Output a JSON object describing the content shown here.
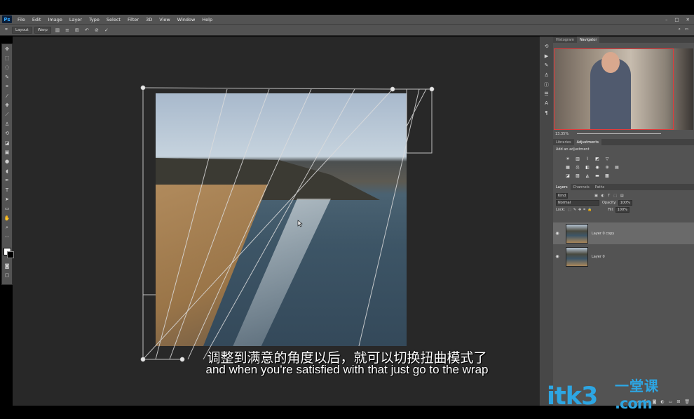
{
  "app": {
    "logo": "Ps"
  },
  "menu": [
    "File",
    "Edit",
    "Image",
    "Layer",
    "Type",
    "Select",
    "Filter",
    "3D",
    "View",
    "Window",
    "Help"
  ],
  "window_controls": [
    "–",
    "□",
    "✕"
  ],
  "options_bar": {
    "layout_label": "Layout",
    "warp_label": "Warp"
  },
  "panels": {
    "top_tabs": [
      "Histogram",
      "Navigator"
    ],
    "navigator_zoom": "13.35%",
    "mid_tabs": [
      "Libraries",
      "Adjustments"
    ],
    "adjustments_title": "Add an adjustment",
    "layer_tabs": [
      "Layers",
      "Channels",
      "Paths"
    ],
    "kind_label": "Kind",
    "blend_mode": "Normal",
    "opacity_label": "Opacity:",
    "opacity_value": "100%",
    "lock_label": "Lock:",
    "fill_label": "Fill:",
    "fill_value": "100%",
    "layers": [
      {
        "name": "Layer 0 copy"
      },
      {
        "name": "Layer 0"
      }
    ]
  },
  "subtitles": {
    "zh": "调整到满意的角度以后，就可以切换扭曲模式了",
    "en": "and when you're satisfied with that just go to the wrap"
  },
  "watermark": {
    "text": "itk3",
    "zh": "一堂课",
    "com": ".com",
    "color": "#2da6e3"
  },
  "icons": {
    "eye": "eye-icon",
    "move": "move-tool-icon"
  }
}
